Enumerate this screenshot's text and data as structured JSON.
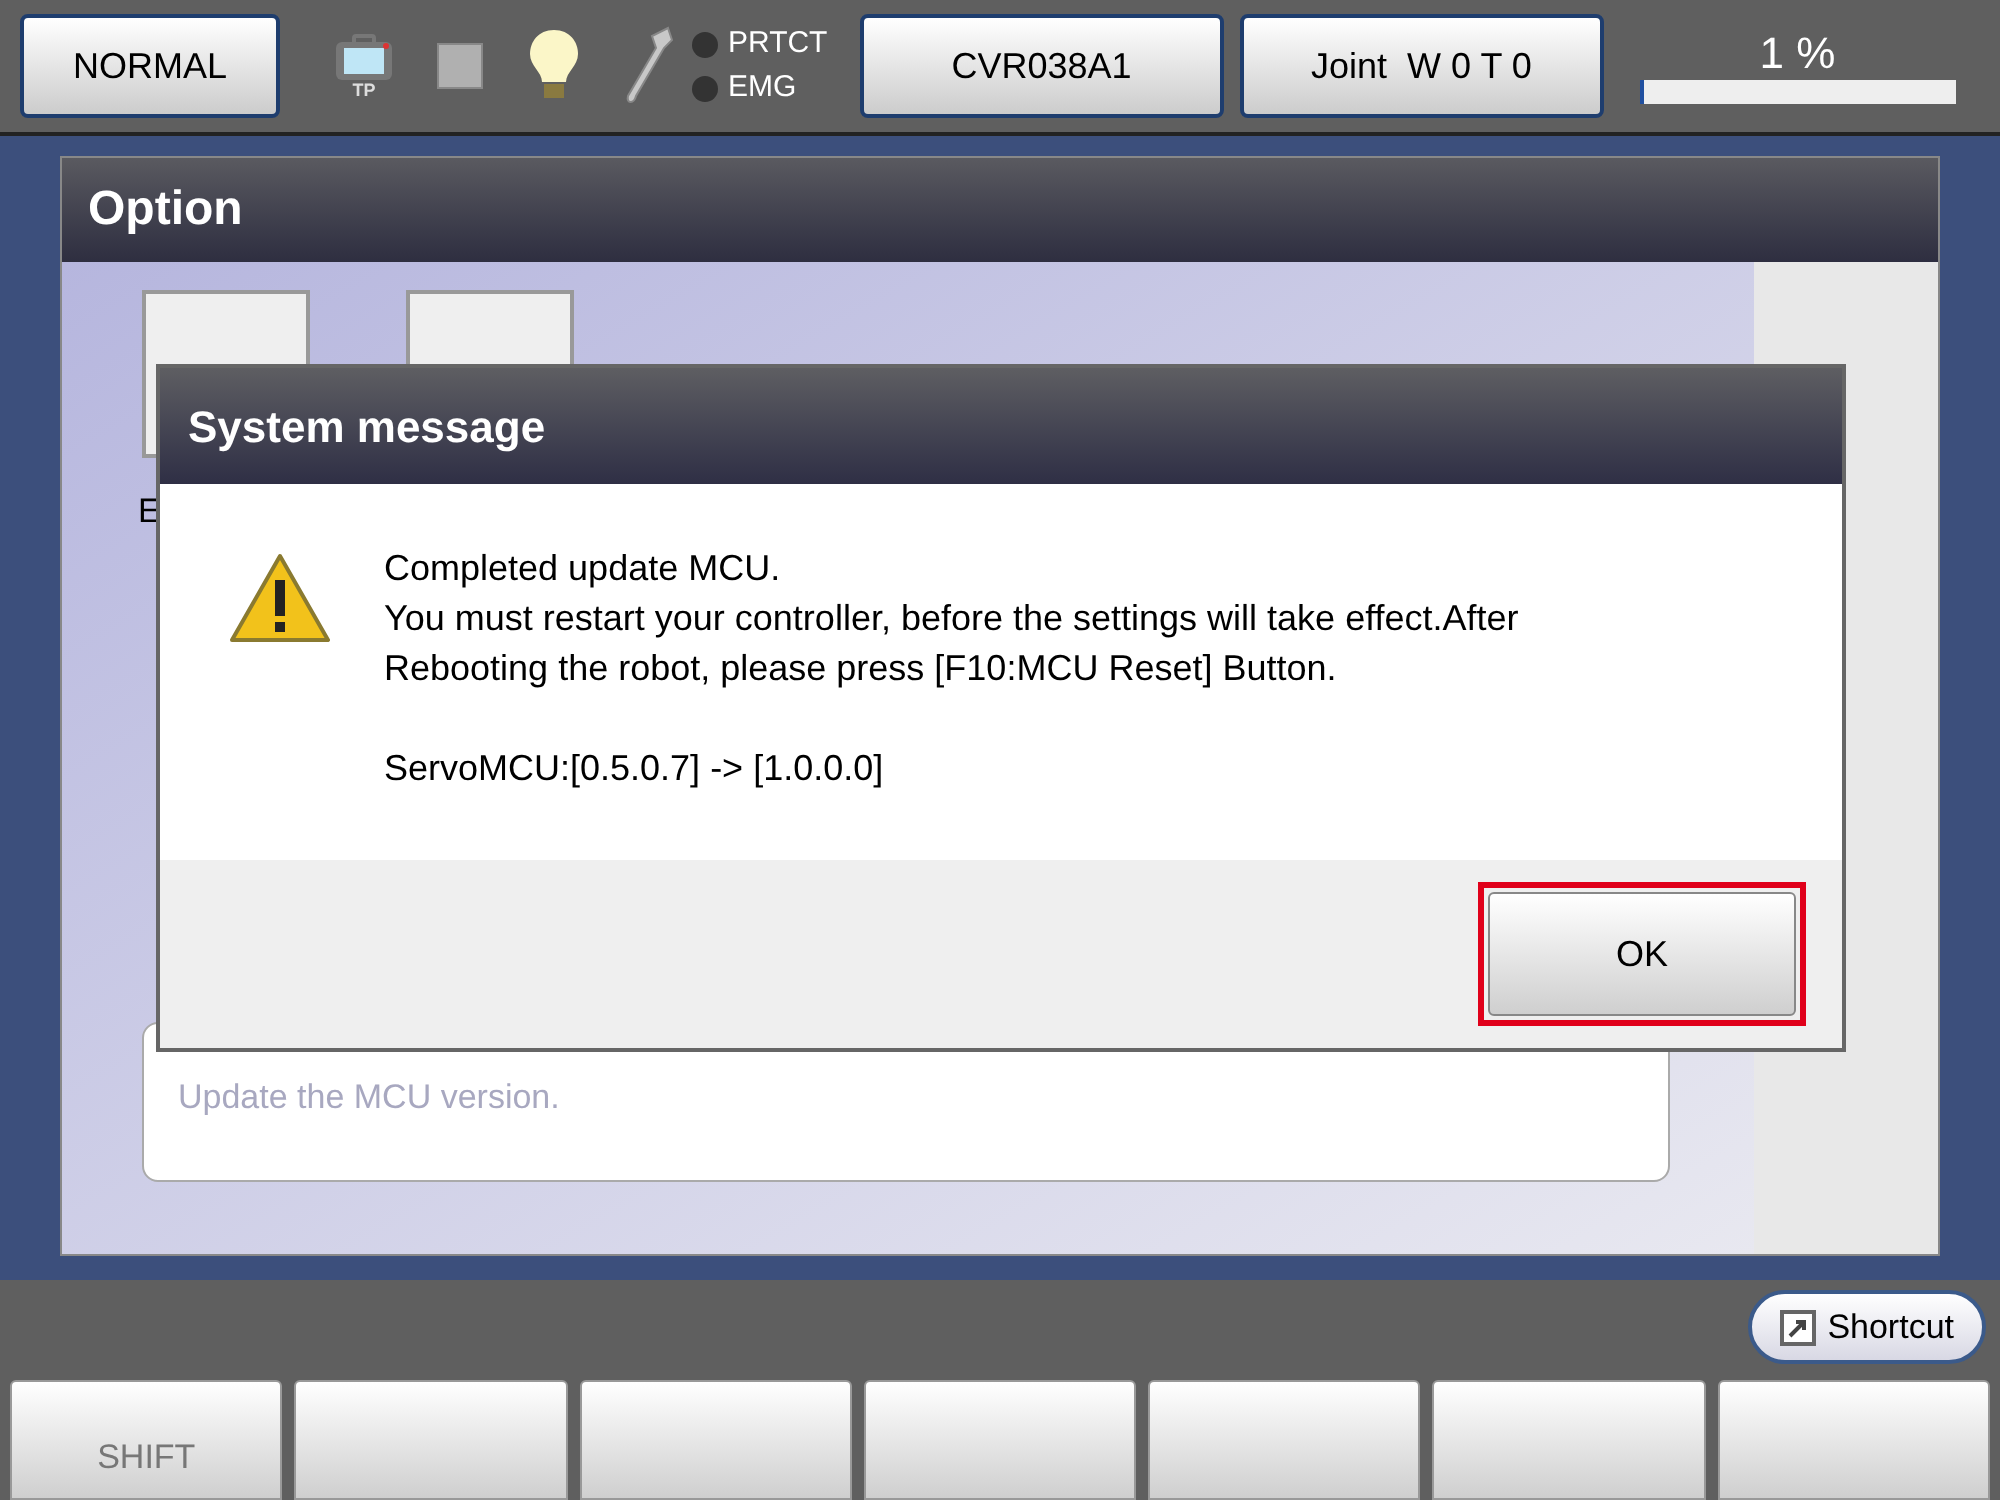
{
  "status_bar": {
    "mode_button": "NORMAL",
    "tp_label": "TP",
    "indicators": [
      {
        "label": "PRTCT",
        "on": false
      },
      {
        "label": "EMG",
        "on": false
      }
    ],
    "robot_button": "CVR038A1",
    "coord_button": "Joint  W 0 T 0",
    "speed": {
      "reading": "1 %",
      "level": 0.01
    }
  },
  "option_panel": {
    "title": "Option",
    "icon_label_fragment": "E",
    "description": "Update the MCU version."
  },
  "dialog": {
    "title": "System message",
    "paragraphs": [
      [
        "Completed update MCU.",
        "You must restart your controller, before the settings will take effect.After Rebooting the robot, please press [F10:MCU Reset] Button."
      ],
      [
        "ServoMCU:[0.5.0.7] -> [1.0.0.0]"
      ]
    ],
    "ok_button": "OK",
    "ok_highlighted": true
  },
  "shortcut_button": "Shortcut",
  "function_key_labels": [
    "SHIFT"
  ]
}
